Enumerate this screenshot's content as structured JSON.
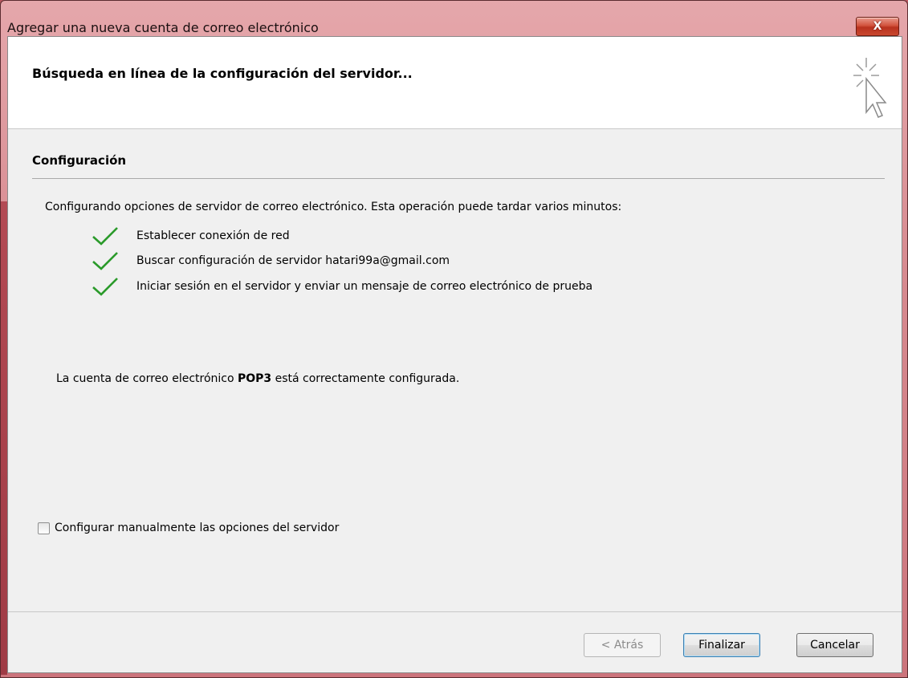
{
  "window": {
    "title": "Agregar una nueva cuenta de correo electrónico",
    "close_label": "X"
  },
  "header": {
    "title": "Búsqueda en línea de la configuración del servidor...",
    "icon": "cursor-sparkle-icon"
  },
  "section": {
    "title": "Configuración",
    "intro": "Configurando opciones de servidor de correo electrónico. Esta operación puede tardar varios minutos:",
    "steps": [
      {
        "label": "Establecer conexión de red",
        "status": "done",
        "icon": "checkmark-icon"
      },
      {
        "label": "Buscar configuración de servidor hatari99a@gmail.com",
        "status": "done",
        "icon": "checkmark-icon"
      },
      {
        "label": "Iniciar sesión en el servidor y enviar un mensaje de correo electrónico de prueba",
        "status": "done",
        "icon": "checkmark-icon"
      }
    ],
    "result_prefix": "La cuenta de correo electrónico ",
    "result_bold": "POP3",
    "result_suffix": " está correctamente configurada."
  },
  "manual_config": {
    "label": "Configurar manualmente las opciones del servidor",
    "checked": false
  },
  "buttons": {
    "back": "< Atrás",
    "finish": "Finalizar",
    "cancel": "Cancelar"
  },
  "colors": {
    "check": "#2a9a2a",
    "titlebar": "#d78a90",
    "close": "#c9472f"
  }
}
